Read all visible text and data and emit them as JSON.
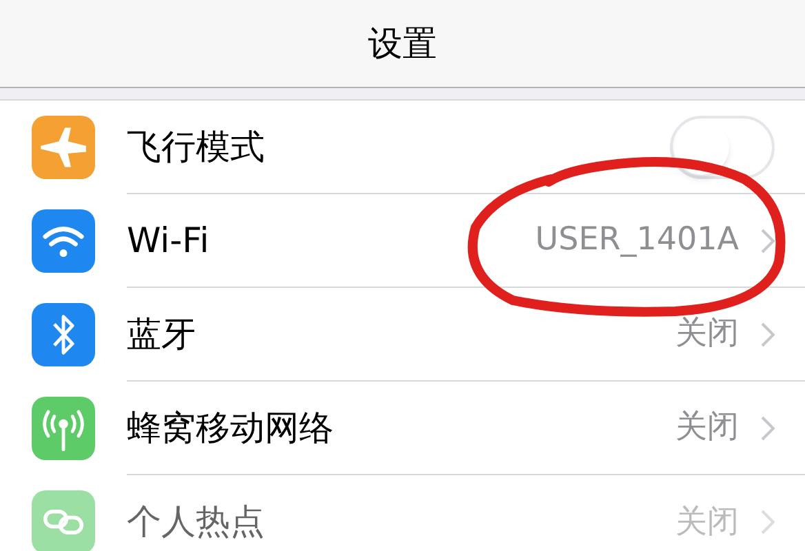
{
  "nav_bar": {
    "title": "设置"
  },
  "rows": [
    {
      "kind": "toggle",
      "label": "飞行模式",
      "on": false,
      "disabled": false
    },
    {
      "kind": "disclosure",
      "label": "Wi-Fi",
      "value": "USER_1401A",
      "disabled": false
    },
    {
      "kind": "disclosure",
      "label": "蓝牙",
      "value": "关闭",
      "disabled": false
    },
    {
      "kind": "disclosure",
      "label": "蜂窝移动网络",
      "value": "关闭",
      "disabled": false
    },
    {
      "kind": "disclosure",
      "label": "个人热点",
      "value": "关闭",
      "disabled": true
    }
  ],
  "annotation": {
    "kind": "circle"
  }
}
